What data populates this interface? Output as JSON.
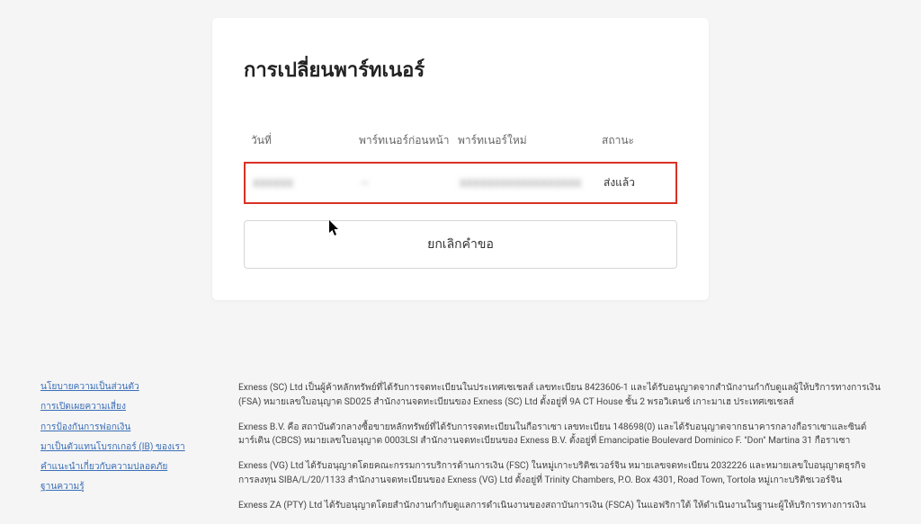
{
  "card": {
    "title": "การเปลี่ยนพาร์ทเนอร์",
    "headers": {
      "date": "วันที่",
      "prev": "พาร์ทเนอร์ก่อนหน้า",
      "new": "พาร์ทเนอร์ใหม่",
      "status": "สถานะ"
    },
    "row": {
      "date": "XXXXXX",
      "prev": "—",
      "new": "XXXXXXXXXXXXXXXXXX",
      "status": "ส่งแล้ว"
    },
    "cancel": "ยกเลิกคำขอ"
  },
  "footer": {
    "links": [
      "นโยบายความเป็นส่วนตัว",
      "การเปิดเผยความเสี่ยง",
      "การป้องกันการฟอกเงิน",
      "มาเป็นตัวแทนโบรกเกอร์ (IB) ของเรา",
      "คำแนะนำเกี่ยวกับความปลอดภัย",
      "ฐานความรู้"
    ],
    "para1": "Exness (SC) Ltd เป็นผู้ค้าหลักทรัพย์ที่ได้รับการจดทะเบียนในประเทศเซเชลส์ เลขทะเบียน 8423606-1 และได้รับอนุญาตจากสำนักงานกำกับดูแลผู้ให้บริการทางการเงิน (FSA) หมายเลขใบอนุญาต SD025 สำนักงานจดทะเบียนของ Exness (SC) Ltd ตั้งอยู่ที่ 9A CT House ชั้น 2 พรอวิเดนซ์ เกาะมาเฮ ประเทศเซเชลส์",
    "para2": "Exness B.V. คือ สถาบันตัวกลางซื้อขายหลักทรัพย์ที่ได้รับการจดทะเบียนในกือราเซา เลขทะเบียน 148698(0) และได้รับอนุญาตจากธนาคารกลางกือราเซาและซินต์มาร์เติน (CBCS) หมายเลขใบอนุญาต 0003LSI สำนักงานจดทะเบียนของ Exness B.V. ตั้งอยู่ที่ Emancipatie Boulevard Dominico F. \"Don\" Martina 31 กือราเซา",
    "para3": "Exness (VG) Ltd ได้รับอนุญาตโดยคณะกรรมการบริการด้านการเงิน (FSC) ในหมู่เกาะบริติชเวอร์จิน หมายเลขจดทะเบียน 2032226 และหมายเลขใบอนุญาตธุรกิจการลงทุน SIBA/L/20/1133 สำนักงานจดทะเบียนของ Exness (VG) Ltd ตั้งอยู่ที่ Trinity Chambers, P.O. Box 4301, Road Town, Tortola หมู่เกาะบริติชเวอร์จิน",
    "para4": "Exness ZA (PTY) Ltd ได้รับอนุญาตโดยสำนักงานกำกับดูแลการดำเนินงานของสถาบันการเงิน (FSCA) ในแอฟริกาใต้ ให้ดำเนินงานในฐานะผู้ให้บริการทางการเงิน"
  }
}
